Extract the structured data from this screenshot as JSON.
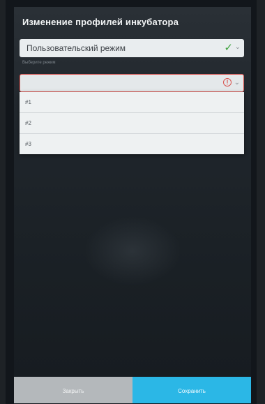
{
  "dialog": {
    "title": "Изменение профилей инкубатора"
  },
  "mode_select": {
    "value": "Пользовательский режим",
    "hint": "Выберите режим",
    "status_icon": "check-icon",
    "status_color": "#3fa33f"
  },
  "profile_select": {
    "value": "",
    "status_icon": "error-icon",
    "status_color": "#d9534f",
    "options": [
      "#1",
      "#2",
      "#3"
    ]
  },
  "footer": {
    "close_label": "Закрыть",
    "save_label": "Сохранить",
    "save_color": "#2bb7e6"
  }
}
